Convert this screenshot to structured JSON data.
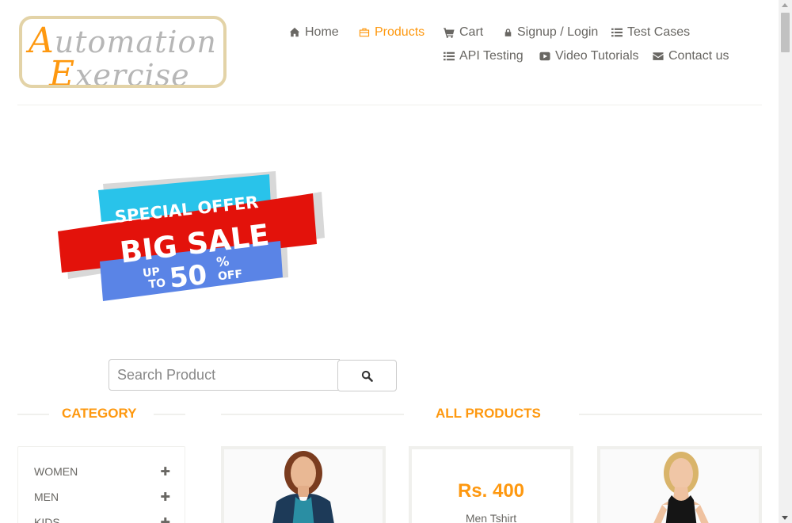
{
  "logo": {
    "line1_first": "A",
    "line1_rest": "utomation",
    "line2_first": "E",
    "line2_rest": "xercise"
  },
  "nav": [
    {
      "label": "Home",
      "icon": "home-icon",
      "active": false
    },
    {
      "label": "Products",
      "icon": "products-icon",
      "active": true
    },
    {
      "label": "Cart",
      "icon": "cart-icon",
      "active": false
    },
    {
      "label": "Signup / Login",
      "icon": "lock-icon",
      "active": false
    },
    {
      "label": "Test Cases",
      "icon": "list-icon",
      "active": false
    },
    {
      "label": "API Testing",
      "icon": "list-icon",
      "active": false
    },
    {
      "label": "Video Tutorials",
      "icon": "youtube-play-icon",
      "active": false
    },
    {
      "label": "Contact us",
      "icon": "envelope-icon",
      "active": false
    }
  ],
  "banner": {
    "line1": "SPECIAL OFFER",
    "line2": "BIG SALE",
    "line3_up": "UP",
    "line3_to": "TO",
    "line3_pct": "50",
    "line3_percent_sign": "%",
    "line3_off": "OFF"
  },
  "search": {
    "placeholder": "Search Product"
  },
  "sections": {
    "category": "CATEGORY",
    "all_products": "ALL PRODUCTS"
  },
  "categories": [
    {
      "label": "WOMEN"
    },
    {
      "label": "MEN"
    },
    {
      "label": "KIDS"
    }
  ],
  "products": [
    {
      "price": "Rs. 400",
      "name": "Men Tshirt"
    }
  ],
  "colors": {
    "accent": "#fe980f",
    "text": "#696763",
    "banner_cyan": "#29c3ea",
    "banner_red": "#e3120b",
    "banner_blue": "#5a84e6"
  }
}
